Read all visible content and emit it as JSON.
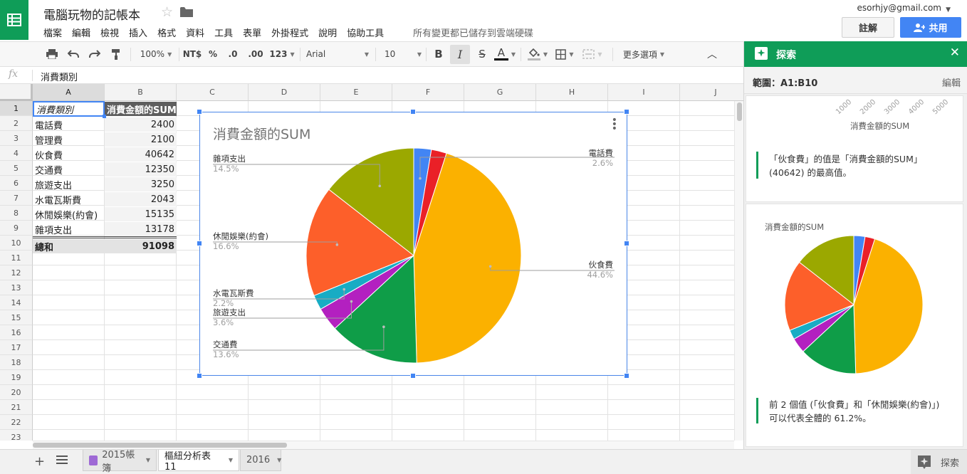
{
  "header": {
    "doc_title": "電腦玩物的記帳本",
    "menu": [
      "檔案",
      "編輯",
      "檢視",
      "插入",
      "格式",
      "資料",
      "工具",
      "表單",
      "外掛程式",
      "說明",
      "協助工具"
    ],
    "save_status": "所有變更都已儲存到雲端硬碟",
    "account": "esorhjy@gmail.com",
    "comment_label": "註解",
    "share_label": "共用"
  },
  "toolbar": {
    "zoom": "100%",
    "currency": "NT$",
    "percent": "%",
    "dec_less": ".0",
    "dec_more": ".00",
    "format_more": "123",
    "font": "Arial",
    "font_size": "10",
    "more_options": "更多選項",
    "bold": "B",
    "italic": "I",
    "strike": "S",
    "text_color": "A"
  },
  "formula_bar": {
    "fx": "fx",
    "value": "消費類別"
  },
  "grid": {
    "columns": [
      "A",
      "B",
      "C",
      "D",
      "E",
      "F",
      "G",
      "H",
      "I",
      "J"
    ],
    "rows": [
      "1",
      "2",
      "3",
      "4",
      "5",
      "6",
      "7",
      "8",
      "9",
      "10",
      "11",
      "12",
      "13",
      "14",
      "15",
      "16",
      "17",
      "18",
      "19",
      "20",
      "21",
      "22",
      "23"
    ],
    "header": {
      "a": "消費類別",
      "b": "消費金額的SUM"
    },
    "data": [
      {
        "a": "電話費",
        "b": "2400"
      },
      {
        "a": "管理費",
        "b": "2100"
      },
      {
        "a": "伙食費",
        "b": "40642"
      },
      {
        "a": "交通費",
        "b": "12350"
      },
      {
        "a": "旅遊支出",
        "b": "3250"
      },
      {
        "a": "水電瓦斯費",
        "b": "2043"
      },
      {
        "a": "休閒娛樂(約會)",
        "b": "15135"
      },
      {
        "a": "雜項支出",
        "b": "13178"
      }
    ],
    "total": {
      "a": "總和",
      "b": "91098"
    }
  },
  "chart": {
    "title": "消費金額的SUM",
    "labels": [
      {
        "name": "電話費",
        "pct": "2.6%"
      },
      {
        "name": "伙食費",
        "pct": "44.6%"
      },
      {
        "name": "交通費",
        "pct": "13.6%"
      },
      {
        "name": "旅遊支出",
        "pct": "3.6%"
      },
      {
        "name": "水電瓦斯費",
        "pct": "2.2%"
      },
      {
        "name": "休閒娛樂(約會)",
        "pct": "16.6%"
      },
      {
        "name": "雜項支出",
        "pct": "14.5%"
      }
    ]
  },
  "chart_data": {
    "type": "pie",
    "title": "消費金額的SUM",
    "categories": [
      "電話費",
      "管理費",
      "伙食費",
      "交通費",
      "旅遊支出",
      "水電瓦斯費",
      "休閒娛樂(約會)",
      "雜項支出"
    ],
    "values": [
      2400,
      2100,
      40642,
      12350,
      3250,
      2043,
      15135,
      13178
    ],
    "colors": [
      "#4285f4",
      "#ea2027",
      "#fbb100",
      "#0f9d48",
      "#b320c0",
      "#18acc4",
      "#fd5f2a",
      "#9ba800"
    ]
  },
  "explore": {
    "title": "探索",
    "range": "範圍：A1:B10",
    "edit": "編輯",
    "mini_ticks": [
      "1000",
      "2000",
      "3000",
      "4000",
      "5000"
    ],
    "card1_axis_label": "消費金額的SUM",
    "insight1_line1": "「伙食費」的值是「消費金額的SUM」",
    "insight1_line2": "(40642) 的最高值。",
    "card2_chart_title": "消費金額的SUM",
    "insight2_line1": "前 2 個值 (「伙食費」和「休閒娛樂(約會)」)",
    "insight2_line2": "可以代表全體的 61.2%。"
  },
  "sheets": {
    "tabs": [
      "2015帳簿",
      "樞紐分析表 11",
      "2016"
    ],
    "explore_label": "探索"
  }
}
